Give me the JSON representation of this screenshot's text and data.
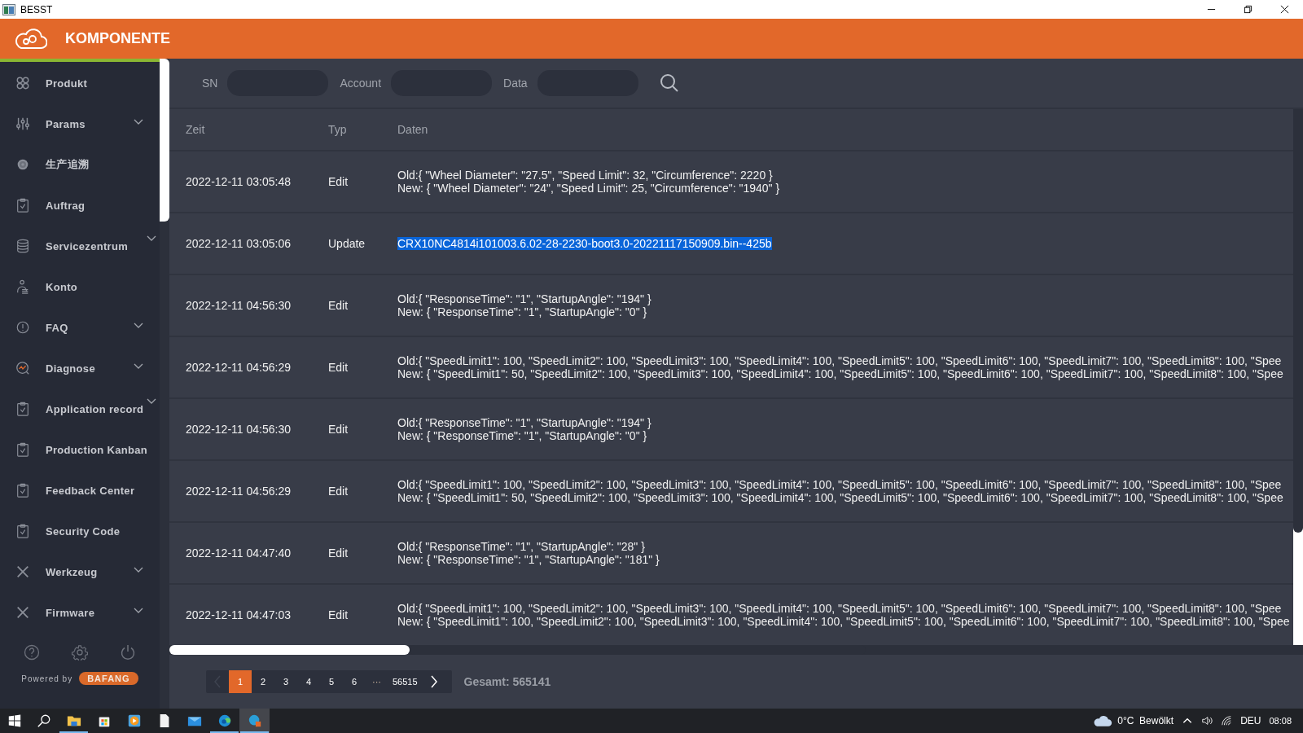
{
  "window": {
    "title": "BESST"
  },
  "header": {
    "title": "KOMPONENTE"
  },
  "sidebar": {
    "items": [
      {
        "label": "Produkt",
        "kind": "link"
      },
      {
        "label": "Params",
        "kind": "group"
      },
      {
        "label": "生产追溯",
        "kind": "link"
      },
      {
        "label": "Auftrag",
        "kind": "link"
      },
      {
        "label": "Servicezentrum",
        "kind": "group"
      },
      {
        "label": "Konto",
        "kind": "link"
      },
      {
        "label": "FAQ",
        "kind": "group"
      },
      {
        "label": "Diagnose",
        "kind": "group"
      },
      {
        "label": "Application record",
        "kind": "group"
      },
      {
        "label": "Production Kanban",
        "kind": "link"
      },
      {
        "label": "Feedback Center",
        "kind": "link"
      },
      {
        "label": "Security Code",
        "kind": "link"
      },
      {
        "label": "Werkzeug",
        "kind": "group"
      },
      {
        "label": "Firmware",
        "kind": "group"
      }
    ],
    "powered_by": "Powered by",
    "brand": "BAFANG"
  },
  "search": {
    "fields": [
      {
        "label": "SN"
      },
      {
        "label": "Account"
      },
      {
        "label": "Data"
      }
    ]
  },
  "table": {
    "columns": [
      "Zeit",
      "Typ",
      "Daten"
    ],
    "rows": [
      {
        "time": "2022-12-11 03:05:48",
        "type": "Edit",
        "highlighted": false,
        "lines": [
          "Old:{ \"Wheel Diameter\": \"27.5\", \"Speed Limit\": 32, \"Circumference\": 2220 }",
          "New: { \"Wheel Diameter\": \"24\", \"Speed Limit\": 25, \"Circumference\": \"1940\" }"
        ]
      },
      {
        "time": "2022-12-11 03:05:06",
        "type": "Update",
        "highlighted": true,
        "lines": [
          "CRX10NC4814i101003.6.02-28-2230-boot3.0-20221117150909.bin--425b"
        ]
      },
      {
        "time": "2022-12-11 04:56:30",
        "type": "Edit",
        "highlighted": false,
        "lines": [
          "Old:{ \"ResponseTime\": \"1\", \"StartupAngle\": \"194\" }",
          "New: { \"ResponseTime\": \"1\", \"StartupAngle\": \"0\" }"
        ]
      },
      {
        "time": "2022-12-11 04:56:29",
        "type": "Edit",
        "highlighted": false,
        "lines": [
          "Old:{ \"SpeedLimit1\": 100, \"SpeedLimit2\": 100, \"SpeedLimit3\": 100, \"SpeedLimit4\": 100, \"SpeedLimit5\": 100, \"SpeedLimit6\": 100, \"SpeedLimit7\": 100, \"SpeedLimit8\": 100, \"Spee",
          "New: { \"SpeedLimit1\": 50, \"SpeedLimit2\": 100, \"SpeedLimit3\": 100, \"SpeedLimit4\": 100, \"SpeedLimit5\": 100, \"SpeedLimit6\": 100, \"SpeedLimit7\": 100, \"SpeedLimit8\": 100, \"Spee"
        ]
      },
      {
        "time": "2022-12-11 04:56:30",
        "type": "Edit",
        "highlighted": false,
        "lines": [
          "Old:{ \"ResponseTime\": \"1\", \"StartupAngle\": \"194\" }",
          "New: { \"ResponseTime\": \"1\", \"StartupAngle\": \"0\" }"
        ]
      },
      {
        "time": "2022-12-11 04:56:29",
        "type": "Edit",
        "highlighted": false,
        "lines": [
          "Old:{ \"SpeedLimit1\": 100, \"SpeedLimit2\": 100, \"SpeedLimit3\": 100, \"SpeedLimit4\": 100, \"SpeedLimit5\": 100, \"SpeedLimit6\": 100, \"SpeedLimit7\": 100, \"SpeedLimit8\": 100, \"Spee",
          "New: { \"SpeedLimit1\": 50, \"SpeedLimit2\": 100, \"SpeedLimit3\": 100, \"SpeedLimit4\": 100, \"SpeedLimit5\": 100, \"SpeedLimit6\": 100, \"SpeedLimit7\": 100, \"SpeedLimit8\": 100, \"Spee"
        ]
      },
      {
        "time": "2022-12-11 04:47:40",
        "type": "Edit",
        "highlighted": false,
        "lines": [
          "Old:{ \"ResponseTime\": \"1\", \"StartupAngle\": \"28\" }",
          "New: { \"ResponseTime\": \"1\", \"StartupAngle\": \"181\" }"
        ]
      },
      {
        "time": "2022-12-11 04:47:03",
        "type": "Edit",
        "highlighted": false,
        "lines": [
          "Old:{ \"SpeedLimit1\": 100, \"SpeedLimit2\": 100, \"SpeedLimit3\": 100, \"SpeedLimit4\": 100, \"SpeedLimit5\": 100, \"SpeedLimit6\": 100, \"SpeedLimit7\": 100, \"SpeedLimit8\": 100, \"Spee",
          "New: { \"SpeedLimit1\": 100, \"SpeedLimit2\": 100, \"SpeedLimit3\": 100, \"SpeedLimit4\": 100, \"SpeedLimit5\": 100, \"SpeedLimit6\": 100, \"SpeedLimit7\": 100, \"SpeedLimit8\": 100, \"Spee"
        ]
      }
    ]
  },
  "pagination": {
    "prev_disabled": true,
    "pages": [
      {
        "label": "1",
        "kind": "page",
        "selected": true
      },
      {
        "label": "2",
        "kind": "page",
        "selected": false
      },
      {
        "label": "3",
        "kind": "page",
        "selected": false
      },
      {
        "label": "4",
        "kind": "page",
        "selected": false
      },
      {
        "label": "5",
        "kind": "page",
        "selected": false
      },
      {
        "label": "6",
        "kind": "page",
        "selected": false
      },
      {
        "label": "···",
        "kind": "more"
      },
      {
        "label": "56515",
        "kind": "page",
        "selected": false
      }
    ],
    "total": "Gesamt: 565141"
  },
  "taskbar": {
    "apps": [
      {
        "running": true,
        "active": false
      },
      {
        "running": false,
        "active": false
      },
      {
        "running": false,
        "active": false
      },
      {
        "running": false,
        "active": false
      },
      {
        "running": false,
        "active": false
      },
      {
        "running": true,
        "active": false
      },
      {
        "running": true,
        "active": true
      }
    ],
    "weather": "0°C  Bewölkt",
    "language": "DEU",
    "time": "08:08"
  }
}
